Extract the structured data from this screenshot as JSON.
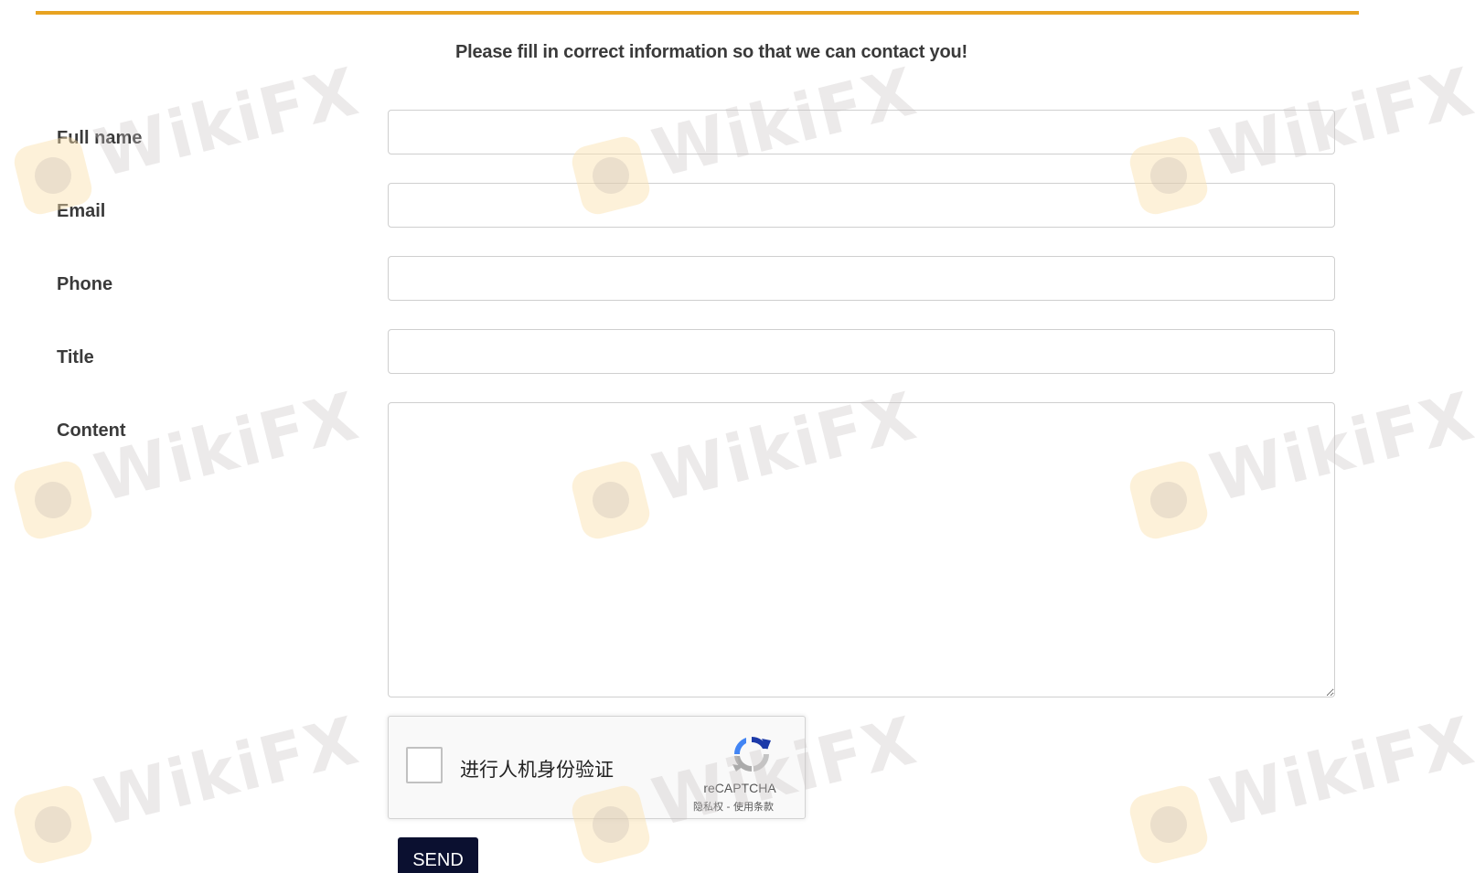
{
  "form": {
    "intro": "Please fill in correct information so that we can contact you!",
    "fields": {
      "full_name": {
        "label": "Full name",
        "value": "",
        "placeholder": ""
      },
      "email": {
        "label": "Email",
        "value": "",
        "placeholder": ""
      },
      "phone": {
        "label": "Phone",
        "value": "",
        "placeholder": ""
      },
      "title": {
        "label": "Title",
        "value": "",
        "placeholder": ""
      },
      "content": {
        "label": "Content",
        "value": "",
        "placeholder": ""
      }
    },
    "send_label": "SEND"
  },
  "recaptcha": {
    "label": "进行人机身份验证",
    "brand": "reCAPTCHA",
    "terms": "隐私权 - 使用条款",
    "checked": false,
    "icon": "recaptcha-logo-icon"
  },
  "watermark": {
    "text": "WikiFX",
    "icon": "wikifx-logo-icon"
  },
  "colors": {
    "accent_rule": "#e8a321",
    "send_button": "#0b1030",
    "text": "#3a3a3a"
  }
}
